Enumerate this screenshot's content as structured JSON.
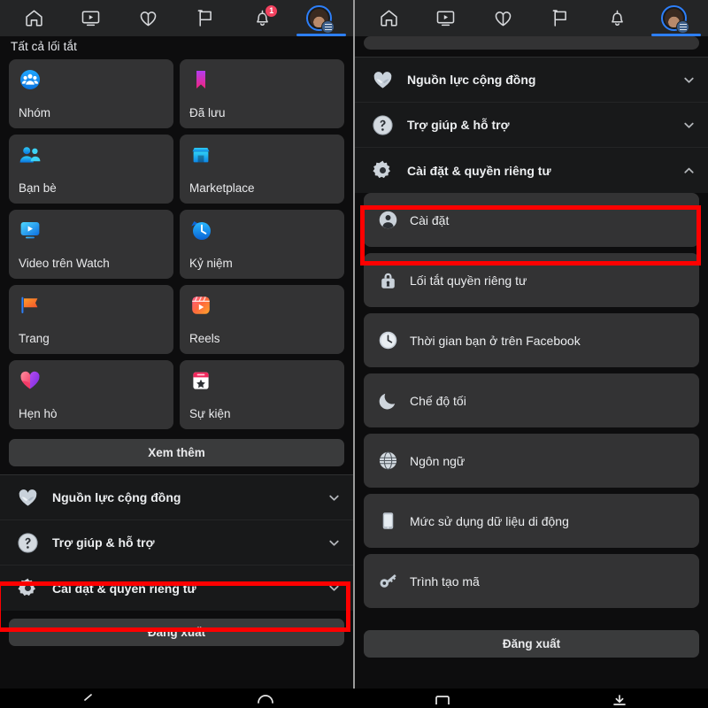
{
  "app": {
    "name": "Facebook",
    "theme": "dark",
    "accent_color": "#2d7ff9",
    "card_color": "#333334",
    "highlight_color": "#fe0000"
  },
  "topnav": {
    "items": [
      {
        "icon": "home-icon",
        "label": "Trang chủ",
        "active": false
      },
      {
        "icon": "video-icon",
        "label": "Video",
        "active": false
      },
      {
        "icon": "dating-heart-icon",
        "label": "Hẹn hò",
        "active": false
      },
      {
        "icon": "flag-icon",
        "label": "Trang",
        "active": false
      },
      {
        "icon": "bell-icon",
        "label": "Thông báo",
        "active": false,
        "badge": "1"
      },
      {
        "icon": "avatar-menu-icon",
        "label": "Menu",
        "active": true
      }
    ]
  },
  "left_panel": {
    "section_title": "Tất cả lối tắt",
    "shortcuts": [
      {
        "label": "Nhóm",
        "icon": "groups-icon"
      },
      {
        "label": "Đã lưu",
        "icon": "saved-bookmark-icon"
      },
      {
        "label": "Bạn bè",
        "icon": "friends-icon"
      },
      {
        "label": "Marketplace",
        "icon": "marketplace-icon"
      },
      {
        "label": "Video trên Watch",
        "icon": "watch-video-icon"
      },
      {
        "label": "Kỷ niệm",
        "icon": "memories-clock-icon"
      },
      {
        "label": "Trang",
        "icon": "pages-flag-icon"
      },
      {
        "label": "Reels",
        "icon": "reels-icon"
      },
      {
        "label": "Hẹn hò",
        "icon": "dating-heart-icon"
      },
      {
        "label": "Sự kiện",
        "icon": "events-calendar-icon"
      }
    ],
    "see_more_label": "Xem thêm",
    "sections": [
      {
        "label": "Nguồn lực cộng đồng",
        "icon": "community-heart-hands-icon",
        "expanded": false,
        "highlighted": false
      },
      {
        "label": "Trợ giúp & hỗ trợ",
        "icon": "help-question-icon",
        "expanded": false,
        "highlighted": false
      },
      {
        "label": "Cài đặt & quyền riêng tư",
        "icon": "settings-gear-icon",
        "expanded": false,
        "highlighted": true
      }
    ],
    "logout_label": "Đăng xuất"
  },
  "right_panel": {
    "sections": [
      {
        "label": "Nguồn lực cộng đồng",
        "icon": "community-heart-hands-icon",
        "expanded": false
      },
      {
        "label": "Trợ giúp & hỗ trợ",
        "icon": "help-question-icon",
        "expanded": false
      },
      {
        "label": "Cài đặt & quyền riêng tư",
        "icon": "settings-gear-icon",
        "expanded": true
      }
    ],
    "submenu": [
      {
        "label": "Cài đặt",
        "icon": "account-person-icon",
        "highlighted": true
      },
      {
        "label": "Lối tắt quyền riêng tư",
        "icon": "privacy-lock-icon",
        "highlighted": false
      },
      {
        "label": "Thời gian bạn ở trên Facebook",
        "icon": "time-clock-icon",
        "highlighted": false
      },
      {
        "label": "Chế độ tối",
        "icon": "dark-mode-moon-icon",
        "highlighted": false
      },
      {
        "label": "Ngôn ngữ",
        "icon": "language-globe-icon",
        "highlighted": false
      },
      {
        "label": "Mức sử dụng dữ liệu di động",
        "icon": "mobile-data-icon",
        "highlighted": false
      },
      {
        "label": "Trình tạo mã",
        "icon": "code-generator-key-icon",
        "highlighted": false
      }
    ],
    "logout_label": "Đăng xuất"
  },
  "android_nav": {
    "items": [
      "back-icon",
      "home-icon",
      "recents-icon",
      "screenshot-icon"
    ]
  }
}
